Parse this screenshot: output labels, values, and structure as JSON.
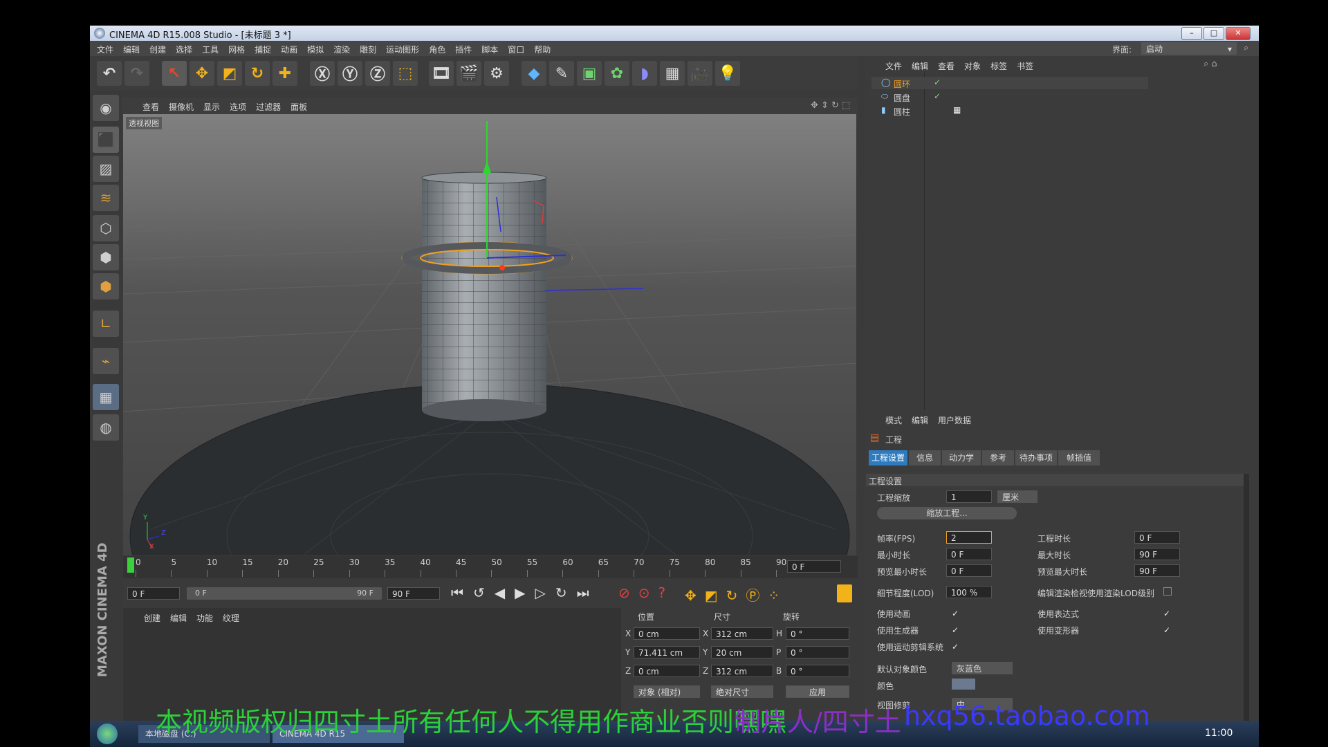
{
  "window": {
    "title": "CINEMA 4D R15.008 Studio - [未标题 3 *]",
    "min": "–",
    "max": "□",
    "close": "✕"
  },
  "menu": [
    "文件",
    "编辑",
    "创建",
    "选择",
    "工具",
    "网格",
    "捕捉",
    "动画",
    "模拟",
    "渲染",
    "雕刻",
    "运动图形",
    "角色",
    "插件",
    "脚本",
    "窗口",
    "帮助"
  ],
  "layout": {
    "label": "界面:",
    "value": "启动"
  },
  "viewport": {
    "menu": [
      "查看",
      "摄像机",
      "显示",
      "选项",
      "过滤器",
      "面板"
    ],
    "label": "透视视图"
  },
  "axis_labels": {
    "x": "X",
    "y": "Y",
    "z": "Z"
  },
  "timeline": {
    "ticks": [
      "0",
      "5",
      "10",
      "15",
      "20",
      "25",
      "30",
      "35",
      "40",
      "45",
      "50",
      "55",
      "60",
      "65",
      "70",
      "75",
      "80",
      "85",
      "90"
    ],
    "current": "0 F"
  },
  "transport": {
    "start": "0 F",
    "range_start": "0 F",
    "range_end": "90 F",
    "end": "90 F"
  },
  "material": {
    "menu": [
      "创建",
      "编辑",
      "功能",
      "纹理"
    ],
    "logo": "MAXON CINEMA 4D"
  },
  "coords": {
    "headers": [
      "位置",
      "尺寸",
      "旋转"
    ],
    "rows": [
      {
        "axis": "X",
        "pos": "0 cm",
        "sizeaxis": "X",
        "size": "312 cm",
        "rotaxis": "H",
        "rot": "0 °"
      },
      {
        "axis": "Y",
        "pos": "71.411 cm",
        "sizeaxis": "Y",
        "size": "20 cm",
        "rotaxis": "P",
        "rot": "0 °"
      },
      {
        "axis": "Z",
        "pos": "0 cm",
        "sizeaxis": "Z",
        "size": "312 cm",
        "rotaxis": "B",
        "rot": "0 °"
      }
    ],
    "mode1": "对象 (相对)",
    "mode2": "绝对尺寸",
    "apply": "应用"
  },
  "objects": {
    "menu": [
      "文件",
      "编辑",
      "查看",
      "对象",
      "标签",
      "书签"
    ],
    "items": [
      "圆环",
      "圆盘",
      "圆柱"
    ]
  },
  "attributes": {
    "menu": [
      "模式",
      "编辑",
      "用户数据"
    ],
    "title": "工程",
    "tabs": [
      "工程设置",
      "信息",
      "动力学",
      "参考",
      "待办事项",
      "帧插值"
    ],
    "section": "工程设置",
    "scale_label": "工程缩放",
    "scale_value": "1",
    "scale_unit": "厘米",
    "scale_button": "缩放工程...",
    "fps_label": "帧率(FPS)",
    "fps_value": "2",
    "duration_label": "工程时长",
    "duration_value": "0 F",
    "min_label": "最小时长",
    "min_value": "0 F",
    "max_label": "最大时长",
    "max_value": "90 F",
    "pmin_label": "预览最小时长",
    "pmin_value": "0 F",
    "pmax_label": "预览最大时长",
    "pmax_value": "90 F",
    "lod_label": "细节程度(LOD)",
    "lod_value": "100 %",
    "lod_render_label": "编辑渲染检视使用渲染LOD级别",
    "anim_label": "使用动画",
    "expr_label": "使用表达式",
    "gen_label": "使用生成器",
    "deform_label": "使用变形器",
    "mograph_label": "使用运动剪辑系统",
    "objcolor_label": "默认对象颜色",
    "objcolor_value": "灰蓝色",
    "color_label": "颜色",
    "clip_label": "视图修剪",
    "clip_value": "中"
  },
  "watermark": {
    "text1": "本视频版权归四寸土所有任何人不得用作商业否则嘿嘿",
    "text2": "制片人/四寸土",
    "text3": "hxq56.taobao.com"
  },
  "taskbar": {
    "time": "11:00",
    "item1": "本地磁盘 (C:)",
    "item2": "CINEMA 4D R15"
  },
  "colors": {
    "accent": "#2f7bbf",
    "selection": "#f0a020",
    "watermark_green": "#2bd13a"
  }
}
